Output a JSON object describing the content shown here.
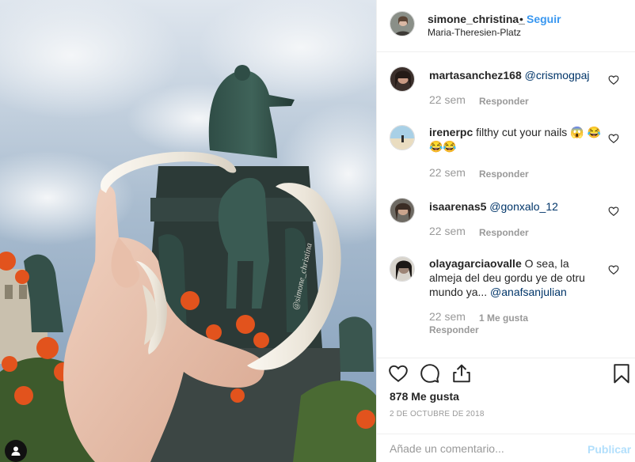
{
  "post": {
    "username": "simone_christina_",
    "separator": "•",
    "follow_label": "Seguir",
    "location": "Maria-Theresien-Platz",
    "watermark": "@simone_christina"
  },
  "comments": [
    {
      "username": "martasanchez168",
      "text": "",
      "mention": "@crismogpaj",
      "text_after": "",
      "time": "22 sem",
      "likes": "",
      "reply_label": "Responder"
    },
    {
      "username": "irenerpc",
      "text": " filthy cut your nails 😱 😂😂😂",
      "mention": "",
      "text_after": "",
      "time": "22 sem",
      "likes": "",
      "reply_label": "Responder"
    },
    {
      "username": "isaarenas5",
      "text": "",
      "mention": "@gonxalo_12",
      "text_after": "",
      "time": "22 sem",
      "likes": "",
      "reply_label": "Responder"
    },
    {
      "username": "olayagarciaovalle",
      "text": " O sea, la almeja del deu gordu ye de otru mundo ya... ",
      "mention": "@anafsanjulian",
      "text_after": "",
      "time": "22 sem",
      "likes": "1 Me gusta",
      "reply_label": "Responder"
    }
  ],
  "actions": {
    "icons": [
      "heart-icon",
      "comment-icon",
      "share-icon",
      "bookmark-icon"
    ],
    "likes_count": "878 Me gusta",
    "date": "2 DE OCTUBRE DE 2018"
  },
  "composer": {
    "placeholder": "Añade un comentario...",
    "publish_label": "Publicar"
  },
  "colors": {
    "link_blue": "#3897f0",
    "mention": "#003569",
    "muted": "#999999",
    "publish_disabled": "#b2dffc",
    "border": "#efefef"
  }
}
